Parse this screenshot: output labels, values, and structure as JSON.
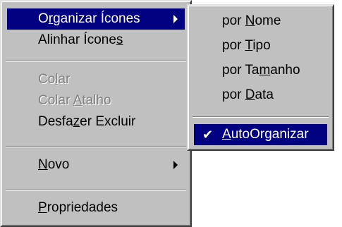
{
  "colors": {
    "menu_face": "#c0c0c0",
    "highlight": "#000080",
    "highlight_text": "#ffffff",
    "disabled_text": "#808080"
  },
  "main_menu": {
    "items": [
      {
        "pre": "O",
        "key": "r",
        "post": "ganizar Ícones",
        "state": "highlighted",
        "submenu": true
      },
      {
        "pre": "Alinhar Ícone",
        "key": "s",
        "post": "",
        "state": "enabled",
        "submenu": false
      },
      {
        "pre": "Co",
        "key": "l",
        "post": "ar",
        "state": "disabled",
        "submenu": false
      },
      {
        "pre": "Colar ",
        "key": "A",
        "post": "talho",
        "state": "disabled",
        "submenu": false
      },
      {
        "pre": "Desfa",
        "key": "z",
        "post": "er Excluir",
        "state": "enabled",
        "submenu": false
      },
      {
        "pre": "",
        "key": "N",
        "post": "ovo",
        "state": "enabled",
        "submenu": true
      },
      {
        "pre": "",
        "key": "P",
        "post": "ropriedades",
        "state": "enabled",
        "submenu": false
      }
    ]
  },
  "submenu": {
    "items": [
      {
        "pre": "por ",
        "key": "N",
        "post": "ome",
        "state": "enabled"
      },
      {
        "pre": "por ",
        "key": "T",
        "post": "ipo",
        "state": "enabled"
      },
      {
        "pre": "por Ta",
        "key": "m",
        "post": "anho",
        "state": "enabled"
      },
      {
        "pre": "por ",
        "key": "D",
        "post": "ata",
        "state": "enabled"
      },
      {
        "pre": "",
        "key": "A",
        "post": "utoOrganizar",
        "state": "highlighted",
        "checked": true,
        "check_glyph": "✔"
      }
    ]
  }
}
